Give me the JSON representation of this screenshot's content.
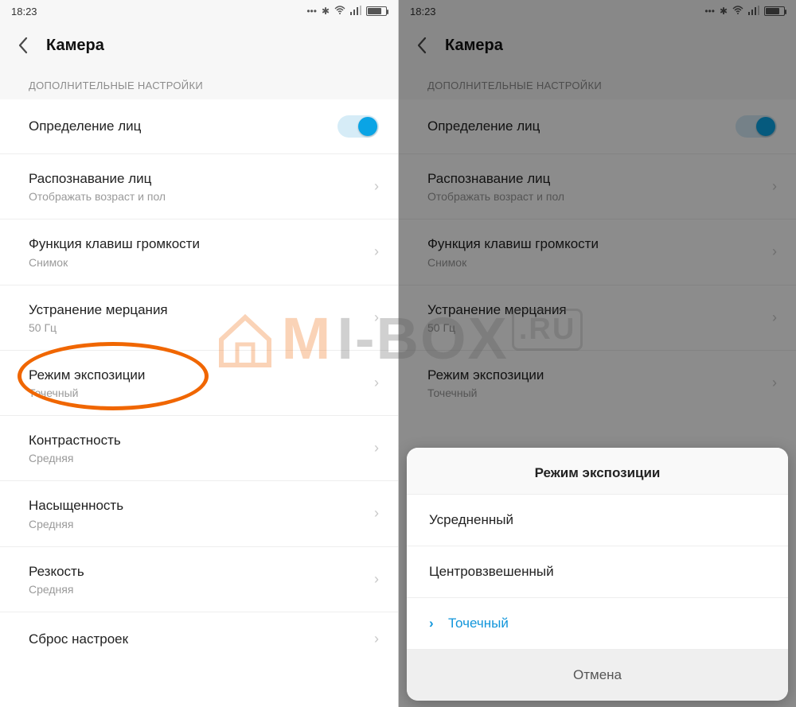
{
  "status": {
    "time": "18:23"
  },
  "header": {
    "title": "Камера"
  },
  "section_label": "ДОПОЛНИТЕЛЬНЫЕ НАСТРОЙКИ",
  "rows": {
    "face_detect": {
      "label": "Определение лиц"
    },
    "face_recog": {
      "label": "Распознавание лиц",
      "sub": "Отображать возраст и пол"
    },
    "vol_key": {
      "label": "Функция клавиш громкости",
      "sub": "Снимок"
    },
    "antiflicker": {
      "label": "Устранение мерцания",
      "sub": "50 Гц"
    },
    "exposure": {
      "label": "Режим экспозиции",
      "sub": "Точечный"
    },
    "contrast": {
      "label": "Контрастность",
      "sub": "Средняя"
    },
    "saturation": {
      "label": "Насыщенность",
      "sub": "Средняя"
    },
    "sharpness": {
      "label": "Резкость",
      "sub": "Средняя"
    },
    "reset": {
      "label": "Сброс настроек"
    }
  },
  "dialog": {
    "title": "Режим экспозиции",
    "options": [
      "Усредненный",
      "Центровзвешенный",
      "Точечный"
    ],
    "selected_index": 2,
    "cancel": "Отмена"
  },
  "watermark": {
    "text_left": "M",
    "text_mid": "I-BOX",
    "text_right": ".RU"
  }
}
